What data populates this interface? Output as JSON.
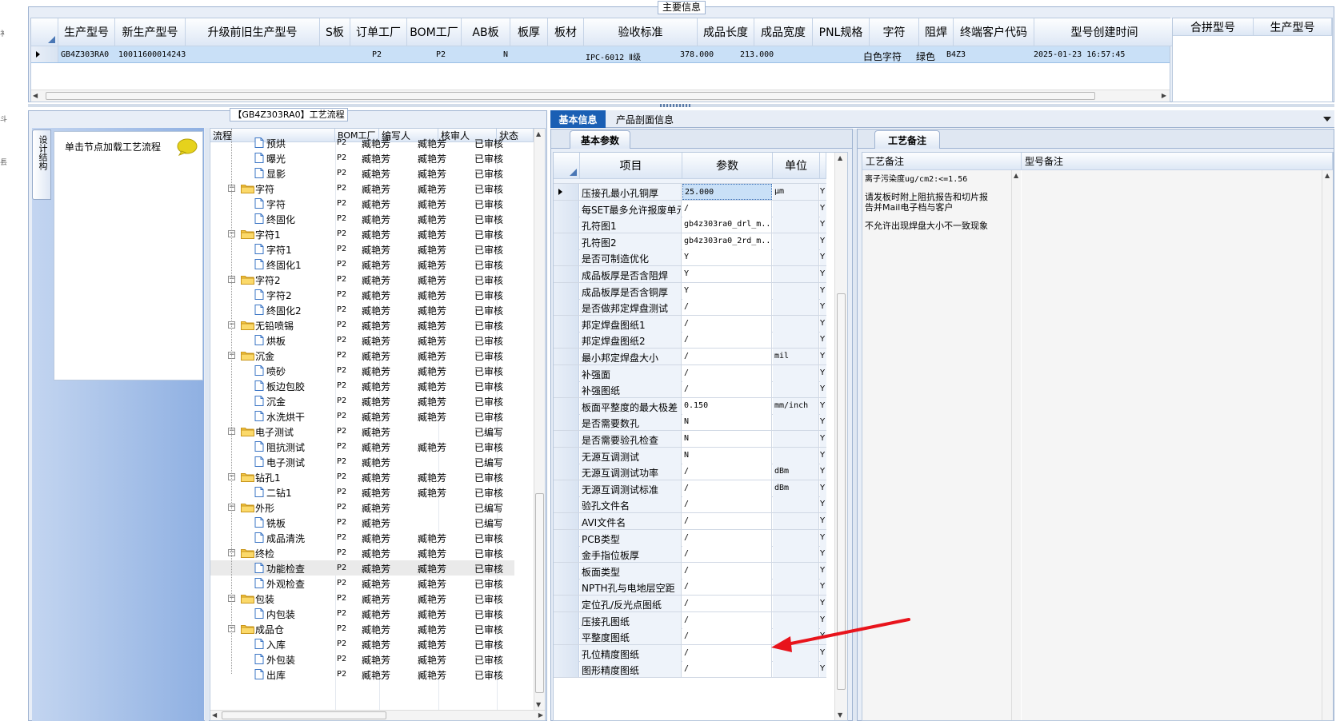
{
  "top_panel": {
    "group_title": "主要信息",
    "columns": [
      "生产型号",
      "新生产型号",
      "升级前旧生产型号",
      "S板",
      "订单工厂",
      "BOM工厂",
      "AB板",
      "板厚",
      "板材",
      "验收标准",
      "成品长度",
      "成品宽度",
      "PNL规格",
      "字符",
      "阻焊",
      "终端客户代码",
      "型号创建时间"
    ],
    "row": {
      "production_model": "GB4Z303RA0",
      "new_model": "10011600014243",
      "old_model": "",
      "s_board": "",
      "order_factory": "P2",
      "bom_factory": "P2",
      "ab_board": "N",
      "thickness": "",
      "material": "",
      "standard": "IPC-6012 Ⅱ级",
      "length": "378.000",
      "width": "213.000",
      "pnl": "",
      "char": "白色字符",
      "solder": "绿色",
      "customer_code": "B4Z3",
      "created": "2025-01-23 16:57:45"
    },
    "merge_columns": [
      "合拼型号",
      "生产型号"
    ]
  },
  "process_panel": {
    "group_title": "【GB4Z303RA0】工艺流程",
    "vertical_tab": "设计结构",
    "hint": "单击节点加载工艺流程",
    "columns": [
      "流程",
      "BOM工厂",
      "编写人",
      "核审人",
      "状态"
    ],
    "rows": [
      {
        "level": 2,
        "name": "预烘",
        "factory": "P2",
        "writer": "臧艳芳",
        "reviewer": "臧艳芳",
        "status": "已审核"
      },
      {
        "level": 2,
        "name": "曝光",
        "factory": "P2",
        "writer": "臧艳芳",
        "reviewer": "臧艳芳",
        "status": "已审核"
      },
      {
        "level": 2,
        "name": "显影",
        "factory": "P2",
        "writer": "臧艳芳",
        "reviewer": "臧艳芳",
        "status": "已审核"
      },
      {
        "level": 1,
        "name": "字符",
        "factory": "P2",
        "writer": "臧艳芳",
        "reviewer": "臧艳芳",
        "status": "已审核"
      },
      {
        "level": 2,
        "name": "字符",
        "factory": "P2",
        "writer": "臧艳芳",
        "reviewer": "臧艳芳",
        "status": "已审核"
      },
      {
        "level": 2,
        "name": "终固化",
        "factory": "P2",
        "writer": "臧艳芳",
        "reviewer": "臧艳芳",
        "status": "已审核"
      },
      {
        "level": 1,
        "name": "字符1",
        "factory": "P2",
        "writer": "臧艳芳",
        "reviewer": "臧艳芳",
        "status": "已审核"
      },
      {
        "level": 2,
        "name": "字符1",
        "factory": "P2",
        "writer": "臧艳芳",
        "reviewer": "臧艳芳",
        "status": "已审核"
      },
      {
        "level": 2,
        "name": "终固化1",
        "factory": "P2",
        "writer": "臧艳芳",
        "reviewer": "臧艳芳",
        "status": "已审核"
      },
      {
        "level": 1,
        "name": "字符2",
        "factory": "P2",
        "writer": "臧艳芳",
        "reviewer": "臧艳芳",
        "status": "已审核"
      },
      {
        "level": 2,
        "name": "字符2",
        "factory": "P2",
        "writer": "臧艳芳",
        "reviewer": "臧艳芳",
        "status": "已审核"
      },
      {
        "level": 2,
        "name": "终固化2",
        "factory": "P2",
        "writer": "臧艳芳",
        "reviewer": "臧艳芳",
        "status": "已审核"
      },
      {
        "level": 1,
        "name": "无铅喷锡",
        "factory": "P2",
        "writer": "臧艳芳",
        "reviewer": "臧艳芳",
        "status": "已审核"
      },
      {
        "level": 2,
        "name": "烘板",
        "factory": "P2",
        "writer": "臧艳芳",
        "reviewer": "臧艳芳",
        "status": "已审核"
      },
      {
        "level": 1,
        "name": "沉金",
        "factory": "P2",
        "writer": "臧艳芳",
        "reviewer": "臧艳芳",
        "status": "已审核"
      },
      {
        "level": 2,
        "name": "喷砂",
        "factory": "P2",
        "writer": "臧艳芳",
        "reviewer": "臧艳芳",
        "status": "已审核"
      },
      {
        "level": 2,
        "name": "板边包胶",
        "factory": "P2",
        "writer": "臧艳芳",
        "reviewer": "臧艳芳",
        "status": "已审核"
      },
      {
        "level": 2,
        "name": "沉金",
        "factory": "P2",
        "writer": "臧艳芳",
        "reviewer": "臧艳芳",
        "status": "已审核"
      },
      {
        "level": 2,
        "name": "水洗烘干",
        "factory": "P2",
        "writer": "臧艳芳",
        "reviewer": "臧艳芳",
        "status": "已审核"
      },
      {
        "level": 1,
        "name": "电子测试",
        "factory": "P2",
        "writer": "臧艳芳",
        "reviewer": "",
        "status": "已编写"
      },
      {
        "level": 2,
        "name": "阻抗测试",
        "factory": "P2",
        "writer": "臧艳芳",
        "reviewer": "臧艳芳",
        "status": "已审核"
      },
      {
        "level": 2,
        "name": "电子测试",
        "factory": "P2",
        "writer": "臧艳芳",
        "reviewer": "",
        "status": "已编写"
      },
      {
        "level": 1,
        "name": "钻孔1",
        "factory": "P2",
        "writer": "臧艳芳",
        "reviewer": "臧艳芳",
        "status": "已审核"
      },
      {
        "level": 2,
        "name": "二钻1",
        "factory": "P2",
        "writer": "臧艳芳",
        "reviewer": "臧艳芳",
        "status": "已审核"
      },
      {
        "level": 1,
        "name": "外形",
        "factory": "P2",
        "writer": "臧艳芳",
        "reviewer": "",
        "status": "已编写"
      },
      {
        "level": 2,
        "name": "铣板",
        "factory": "P2",
        "writer": "臧艳芳",
        "reviewer": "",
        "status": "已编写"
      },
      {
        "level": 2,
        "name": "成品清洗",
        "factory": "P2",
        "writer": "臧艳芳",
        "reviewer": "臧艳芳",
        "status": "已审核"
      },
      {
        "level": 1,
        "name": "终检",
        "factory": "P2",
        "writer": "臧艳芳",
        "reviewer": "臧艳芳",
        "status": "已审核"
      },
      {
        "level": 2,
        "name": "功能检查",
        "factory": "P2",
        "writer": "臧艳芳",
        "reviewer": "臧艳芳",
        "status": "已审核"
      },
      {
        "level": 2,
        "name": "外观检查",
        "factory": "P2",
        "writer": "臧艳芳",
        "reviewer": "臧艳芳",
        "status": "已审核"
      },
      {
        "level": 1,
        "name": "包装",
        "factory": "P2",
        "writer": "臧艳芳",
        "reviewer": "臧艳芳",
        "status": "已审核"
      },
      {
        "level": 2,
        "name": "内包装",
        "factory": "P2",
        "writer": "臧艳芳",
        "reviewer": "臧艳芳",
        "status": "已审核"
      },
      {
        "level": 1,
        "name": "成品仓",
        "factory": "P2",
        "writer": "臧艳芳",
        "reviewer": "臧艳芳",
        "status": "已审核"
      },
      {
        "level": 2,
        "name": "入库",
        "factory": "P2",
        "writer": "臧艳芳",
        "reviewer": "臧艳芳",
        "status": "已审核"
      },
      {
        "level": 2,
        "name": "外包装",
        "factory": "P2",
        "writer": "臧艳芳",
        "reviewer": "臧艳芳",
        "status": "已审核"
      },
      {
        "level": 2,
        "name": "出库",
        "factory": "P2",
        "writer": "臧艳芳",
        "reviewer": "臧艳芳",
        "status": "已审核"
      }
    ]
  },
  "info_tabs": [
    "基本信息",
    "产品剖面信息"
  ],
  "params_panel": {
    "tab": "基本参数",
    "columns": [
      "项目",
      "参数",
      "单位"
    ],
    "rows": [
      {
        "item": "压接孔最小孔铜厚",
        "value": "25.000",
        "unit": "μm",
        "flag": "Y"
      },
      {
        "item": "每SET最多允许报废单元",
        "value": "/",
        "unit": "",
        "flag": "Y"
      },
      {
        "item": "孔符图1",
        "value": "gb4z303ra0_drl_m...",
        "unit": "",
        "flag": "Y"
      },
      {
        "item": "孔符图2",
        "value": "gb4z303ra0_2rd_m...",
        "unit": "",
        "flag": "Y"
      },
      {
        "item": "是否可制造优化",
        "value": "Y",
        "unit": "",
        "flag": "Y"
      },
      {
        "item": "成品板厚是否含阻焊",
        "value": "Y",
        "unit": "",
        "flag": "Y"
      },
      {
        "item": "成品板厚是否含铜厚",
        "value": "Y",
        "unit": "",
        "flag": "Y"
      },
      {
        "item": "是否做邦定焊盘测试",
        "value": "/",
        "unit": "",
        "flag": "Y"
      },
      {
        "item": "邦定焊盘图纸1",
        "value": "/",
        "unit": "",
        "flag": "Y"
      },
      {
        "item": "邦定焊盘图纸2",
        "value": "/",
        "unit": "",
        "flag": "Y"
      },
      {
        "item": "最小邦定焊盘大小",
        "value": "/",
        "unit": "mil",
        "flag": "Y"
      },
      {
        "item": "补强面",
        "value": "/",
        "unit": "",
        "flag": "Y"
      },
      {
        "item": "补强图纸",
        "value": "/",
        "unit": "",
        "flag": "Y"
      },
      {
        "item": "板面平整度的最大极差",
        "value": "0.150",
        "unit": "mm/inch",
        "flag": "Y"
      },
      {
        "item": "是否需要数孔",
        "value": "N",
        "unit": "",
        "flag": "Y"
      },
      {
        "item": "是否需要验孔检查",
        "value": "N",
        "unit": "",
        "flag": "Y"
      },
      {
        "item": "无源互调测试",
        "value": "N",
        "unit": "",
        "flag": "Y"
      },
      {
        "item": "无源互调测试功率",
        "value": "/",
        "unit": "dBm",
        "flag": "Y"
      },
      {
        "item": "无源互调测试标准",
        "value": "/",
        "unit": "dBm",
        "flag": "Y"
      },
      {
        "item": "验孔文件名",
        "value": "/",
        "unit": "",
        "flag": "Y"
      },
      {
        "item": "AVI文件名",
        "value": "/",
        "unit": "",
        "flag": "Y"
      },
      {
        "item": "PCB类型",
        "value": "/",
        "unit": "",
        "flag": "Y"
      },
      {
        "item": "金手指位板厚",
        "value": "/",
        "unit": "",
        "flag": "Y"
      },
      {
        "item": "板面类型",
        "value": "/",
        "unit": "",
        "flag": "Y"
      },
      {
        "item": "NPTH孔与电地层空距",
        "value": "/",
        "unit": "",
        "flag": "Y"
      },
      {
        "item": "定位孔/反光点图纸",
        "value": "/",
        "unit": "",
        "flag": "Y"
      },
      {
        "item": "压接孔图纸",
        "value": "/",
        "unit": "",
        "flag": "Y"
      },
      {
        "item": "平整度图纸",
        "value": "/",
        "unit": "",
        "flag": "Y"
      },
      {
        "item": "孔位精度图纸",
        "value": "/",
        "unit": "",
        "flag": "Y"
      },
      {
        "item": "图形精度图纸",
        "value": "/",
        "unit": "",
        "flag": "Y"
      }
    ]
  },
  "remarks_panel": {
    "tab": "工艺备注",
    "columns": [
      "工艺备注",
      "型号备注"
    ],
    "lines": [
      "离子污染度ug/cm2:<=1.56",
      "请发板时附上阻抗报告和切片报",
      "告并Mail电子档与客户",
      "不允许出现焊盘大小不一致现象"
    ]
  },
  "left_edge": [
    "衤",
    "斗",
    "镸"
  ],
  "colors": {
    "accent": "#1a5fb4",
    "selection": "#c9e0f7",
    "arrow": "#e8141c"
  }
}
